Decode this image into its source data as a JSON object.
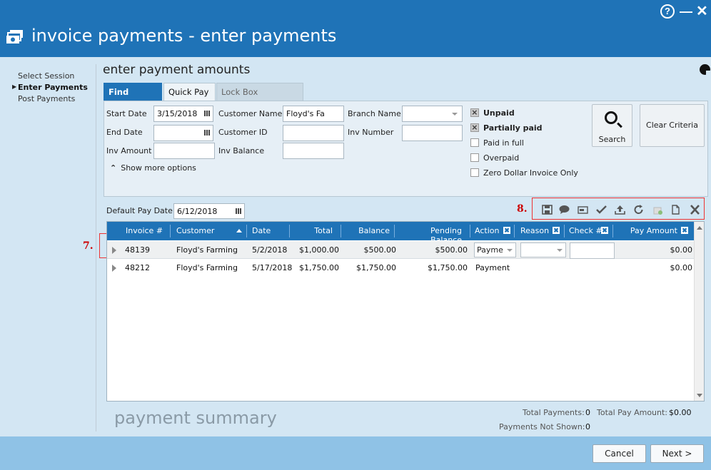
{
  "window": {
    "title": "invoice payments - enter payments",
    "help_glyph": "?",
    "minimize_glyph": "—",
    "close_glyph": "✕"
  },
  "nav": {
    "items": [
      {
        "label": "Select Session",
        "active": false
      },
      {
        "label": "Enter Payments",
        "active": true
      },
      {
        "label": "Post Payments",
        "active": false
      }
    ],
    "active_arrow": "▶"
  },
  "section": {
    "title": "enter payment amounts"
  },
  "tabs": [
    {
      "label": "Find Invoices",
      "active": true
    },
    {
      "label": "Quick Pay",
      "active": false
    },
    {
      "label": "Lock Box Corrections",
      "active": false
    }
  ],
  "criteria": {
    "start_date_label": "Start Date",
    "start_date_value": "3/15/2018",
    "end_date_label": "End Date",
    "end_date_value": "",
    "inv_amount_label": "Inv Amount",
    "inv_amount_value": "",
    "customer_name_label": "Customer Name",
    "customer_name_value": "Floyd's Fa",
    "customer_id_label": "Customer ID",
    "customer_id_value": "",
    "inv_balance_label": "Inv Balance",
    "inv_balance_value": "",
    "branch_name_label": "Branch Name",
    "branch_name_value": "",
    "inv_number_label": "Inv Number",
    "inv_number_value": "",
    "show_more_label": "Show more options",
    "checkboxes": [
      {
        "label": "Unpaid",
        "checked": true
      },
      {
        "label": "Partially paid",
        "checked": true
      },
      {
        "label": "Paid in full",
        "checked": false
      },
      {
        "label": "Overpaid",
        "checked": false
      },
      {
        "label": "Zero Dollar Invoice Only",
        "checked": false
      }
    ],
    "search_label": "Search",
    "clear_label": "Clear Criteria"
  },
  "default_pay_date": {
    "label": "Default Pay Date:",
    "value": "6/12/2018"
  },
  "markers": {
    "seven": "7.",
    "eight": "8."
  },
  "toolbar_icons": [
    "save-icon",
    "comment-icon",
    "card-icon",
    "checkmark-icon",
    "upload-icon",
    "refresh-icon",
    "ledger-icon",
    "document-icon",
    "delete-icon"
  ],
  "grid": {
    "columns": {
      "invoice": "Invoice #",
      "customer": "Customer",
      "date": "Date",
      "total": "Total",
      "balance": "Balance",
      "pending": "Pending Balance",
      "action": "Action",
      "reason": "Reason",
      "check": "Check #",
      "pay_amount": "Pay Amount"
    },
    "rows": [
      {
        "invoice": "48139",
        "customer": "Floyd's Farming",
        "date": "5/2/2018",
        "total": "$1,000.00",
        "balance": "$500.00",
        "pending": "$500.00",
        "action": "Payme",
        "reason": "",
        "check": "",
        "pay_amount": "$0.00"
      },
      {
        "invoice": "48212",
        "customer": "Floyd's Farming",
        "date": "5/17/2018",
        "total": "$1,750.00",
        "balance": "$1,750.00",
        "pending": "$1,750.00",
        "action": "Payment",
        "reason": "",
        "check": "",
        "pay_amount": "$0.00"
      }
    ]
  },
  "summary": {
    "title": "payment summary",
    "total_payments_label": "Total Payments:",
    "total_payments_value": "0",
    "total_pay_amount_label": "Total Pay Amount:",
    "total_pay_amount_value": "$0.00",
    "not_shown_label": "Payments Not Shown:",
    "not_shown_value": "0"
  },
  "footer": {
    "cancel_label": "Cancel",
    "next_label": "Next >"
  },
  "colors": {
    "accent": "#1f73b7",
    "background": "#d3e6f3",
    "footer": "#8fc2e6",
    "marker": "#cc0000"
  }
}
